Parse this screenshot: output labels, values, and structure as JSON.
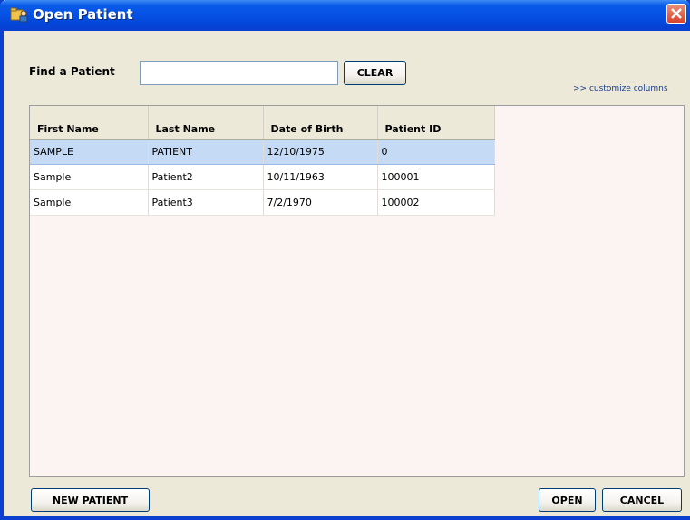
{
  "window": {
    "title": "Open Patient",
    "title_icon": "patient-folder-icon",
    "close_icon": "close-icon"
  },
  "search": {
    "label": "Find a Patient",
    "value": "",
    "placeholder": "",
    "clear_label": "CLEAR"
  },
  "customize_link": ">> customize columns",
  "table": {
    "headers": [
      "First Name",
      "Last Name",
      "Date of Birth",
      "Patient ID"
    ],
    "rows": [
      {
        "first": "SAMPLE",
        "last": "PATIENT",
        "dob": "12/10/1975",
        "id": "0",
        "selected": true
      },
      {
        "first": "Sample",
        "last": "Patient2",
        "dob": "10/11/1963",
        "id": "100001",
        "selected": false
      },
      {
        "first": "Sample",
        "last": "Patient3",
        "dob": "7/2/1970",
        "id": "100002",
        "selected": false
      }
    ]
  },
  "footer": {
    "new_label": "NEW PATIENT",
    "open_label": "OPEN",
    "cancel_label": "CANCEL"
  },
  "colors": {
    "titlebar": "#0551e3",
    "close": "#d6432a",
    "selected_row": "#c5daf4",
    "list_bg": "#fcf4f2",
    "dialog_bg": "#ece9d8"
  }
}
